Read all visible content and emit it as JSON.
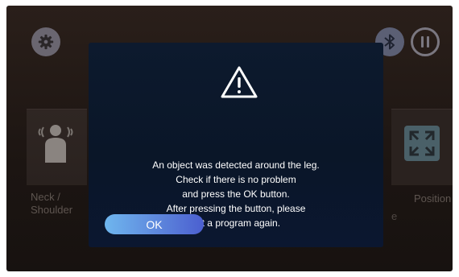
{
  "screen": {
    "background_color": "#1c1512",
    "icons": {
      "settings": "gear-icon",
      "bluetooth": "bluetooth-icon",
      "pause": "pause-icon",
      "neck": "person-massage-icon",
      "position": "expand-arrows-icon"
    },
    "tiles": {
      "neck_label": "Neck /\nShoulder",
      "position_label": "Position",
      "partial_label": "e"
    }
  },
  "dialog": {
    "icon": "warning-triangle-icon",
    "message_lines": [
      "An object was detected around the leg.",
      "Check if there is no problem",
      "and press the OK button.",
      "After pressing the button, please",
      "set a program again."
    ],
    "ok_label": "OK",
    "background_color": "#0a1628",
    "button_color": "#5d86dc"
  }
}
